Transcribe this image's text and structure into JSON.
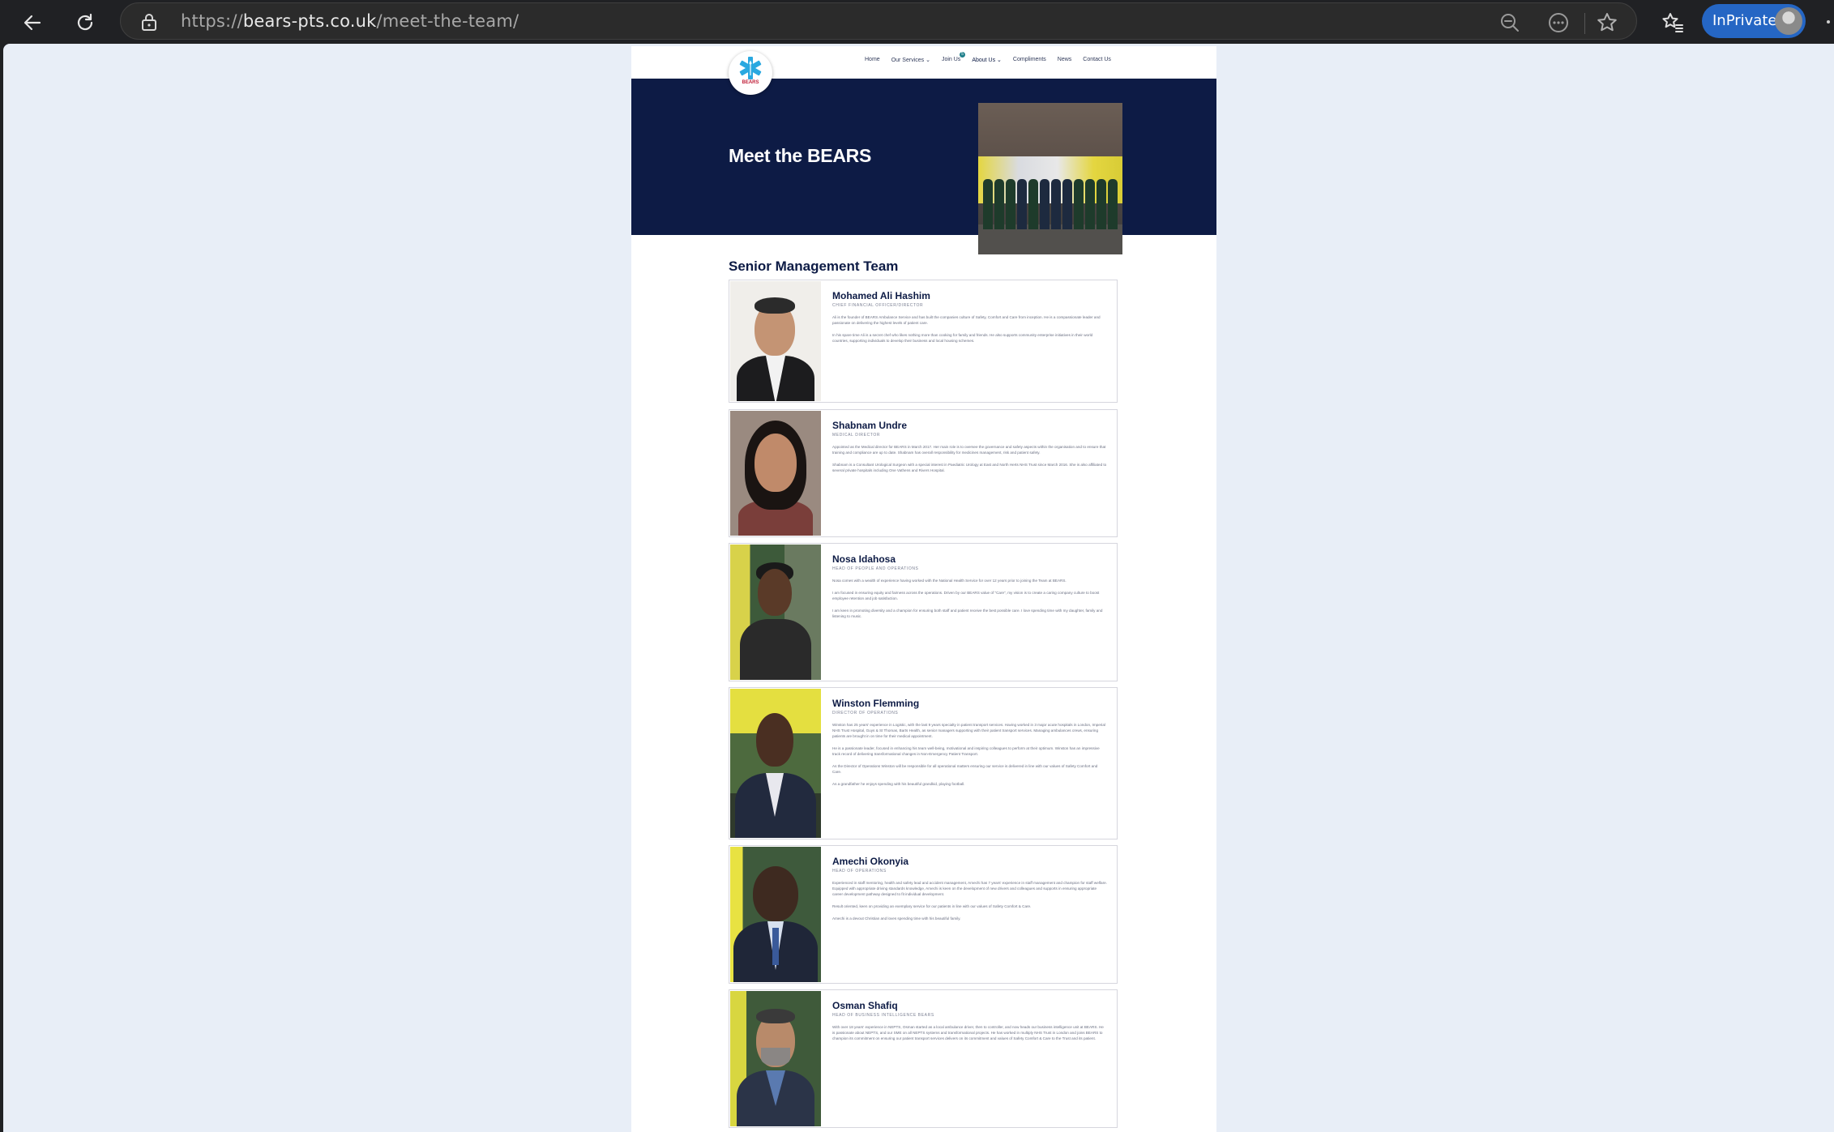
{
  "browser": {
    "url_scheme": "https://",
    "url_domain": "bears-pts.co.uk",
    "url_path": "/meet-the-team/",
    "inprivate_label": "InPrivate"
  },
  "site": {
    "logo_text": "BEARS",
    "nav": {
      "home": "Home",
      "services": "Our Services",
      "join": "Join Us",
      "join_badge": "5",
      "about": "About Us",
      "compliments": "Compliments",
      "news": "News",
      "contact": "Contact Us"
    }
  },
  "hero": {
    "title": "Meet the BEARS"
  },
  "section": {
    "title": "Senior Management Team"
  },
  "team": [
    {
      "name": "Mohamed Ali Hashim",
      "role": "CHIEF FINANCIAL OFFICER/DIRECTOR",
      "paragraphs": [
        "Ali is the founder of BEARS Ambulance Service and has built the companies culture of Safety, Comfort and Care from inception. He is a compassionate leader and passionate on delivering the highest levels of patient care.",
        "In his spare time Ali is a secret chef who likes nothing more than cooking for family and friends. He also supports community enterprise initiatives in their world countries, supporting individuals to develop their business and local housing schemes."
      ]
    },
    {
      "name": "Shabnam Undre",
      "role": "MEDICAL DIRECTOR",
      "paragraphs": [
        "Appointed as the Medical director for BEARS in March 2017. Her main role is to oversee the governance and safety aspects within the organisation and to ensure that training and compliance are up to date. Shabnam has overall responsibility for medicines management, risk and patient safety.",
        "Shabnam is a Consultant Urological Surgeon with a special interest in Paediatric Urology at East and North Herts NHS Trust since March 2016. She is also affiliated to several private hospitals including One Vathens and Rivers Hospital."
      ]
    },
    {
      "name": "Nosa Idahosa",
      "role": "HEAD OF PEOPLE AND OPERATIONS",
      "paragraphs": [
        "Nosa comes with a wealth of experience having worked with the National Health Service for over 12 years prior to joining the Team at BEARS.",
        "I am focused in ensuring equity and fairness across the operations. Driven by our BEARS value of \"Care\", my vision is to create a caring company culture to boost employee retention and job satisfaction.",
        "I am keen in promoting diversity and a champion for ensuring both staff and patient receive the best possible care. I love spending time with my daughter, family and listening to music."
      ]
    },
    {
      "name": "Winston Flemming",
      "role": "DIRECTOR OF OPERATIONS",
      "paragraphs": [
        "Winston has 25 years' experience in Logistic, with the last 9 years specialty in patient transport services. Having worked in 3 major acute hospitals in London, Imperial NHS Trust Hospital, Guys & St Thomas, Barts Health, as senior managers supporting with their patient transport services. Managing ambulances crews, ensuring patients are brought in on time for their medical appointment.",
        "He is a passionate leader, focused in enhancing his team well-being, motivational and inspiring colleagues to perform at their optimum. Winston has an impressive track record of delivering transformational changes in Non-Emergency Patient Transport.",
        "As the Director of Operations Winston will be responsible for all operational matters ensuring our service is delivered in line with our values of Safety Comfort and Care.",
        "As a grandfather he enjoys spending with his beautiful grandkid, playing football."
      ]
    },
    {
      "name": "Amechi Okonyia",
      "role": "HEAD OF OPERATIONS",
      "paragraphs": [
        "Experienced in staff mentoring, health and safety lead and accident management, Amechi has 7 years' experience in staff management and champion for staff welfare. Equipped with appropriate driving standards knowledge, Amechi is keen on the development of new drivers and colleagues and supports in ensuring appropriate career development pathway designed to fit individual development.",
        "Result oriented, keen on providing an exemplary service for our patients in line with our values of Safety Comfort & Care.",
        "Amechi is a devout Christian and loves spending time with his beautiful family."
      ]
    },
    {
      "name": "Osman Shafiq",
      "role": "HEAD OF BUSINESS INTELLIGENCE BEARS",
      "paragraphs": [
        "With over 18 years' experience in NEPTS, Osman started as a local ambulance driver, then to controller, and now heads our business intelligence unit at BEARS. He is passionate about NEPTS, and our SME on all NEPTS systems and transformational projects. He has worked in multiply NHS Trust in London and joins BEARS to champion its commitment on ensuring our patient transport services delivers on its commitment and values of Safety Comfort & Care to the Trust and its patient."
      ]
    }
  ],
  "colors": {
    "navy": "#0d1b45",
    "browser_bg": "#202124",
    "viewport_bg": "#e8eef7",
    "inprivate_blue": "#2566c4",
    "logo_blue": "#2aa8e0",
    "logo_red": "#c0203a"
  },
  "icons": [
    "back-icon",
    "refresh-icon",
    "lock-icon",
    "zoom-out-icon",
    "more-icon",
    "star-icon",
    "favorites-icon",
    "profile-avatar"
  ]
}
